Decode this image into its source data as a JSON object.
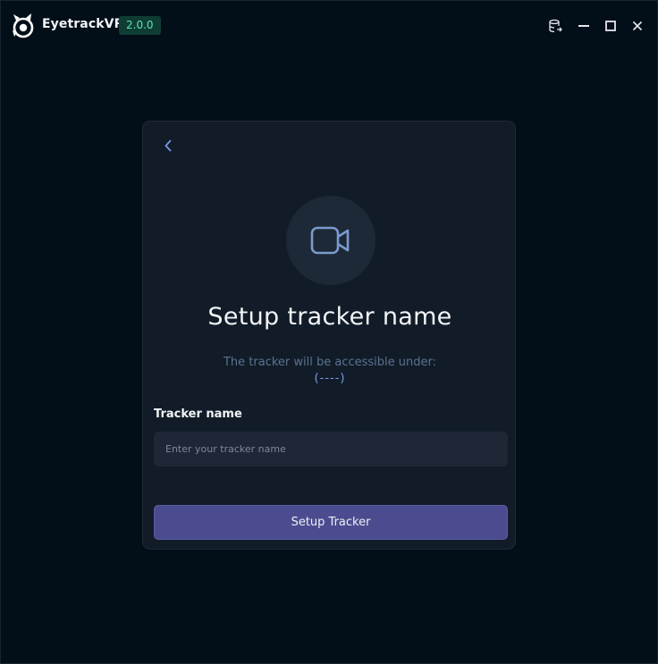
{
  "app": {
    "title": "EyetrackVR",
    "version": "2.0.0"
  },
  "titlebar": {
    "icons": [
      "database-export-icon",
      "minimize-icon",
      "maximize-icon",
      "close-icon"
    ]
  },
  "card": {
    "back_icon": "chevron-left-icon",
    "hero_icon": "video-camera-icon",
    "title": "Setup tracker name",
    "subtitle": "The tracker will be accessible under:",
    "path": "(----)",
    "field_label": "Tracker name",
    "field_placeholder": "Enter your tracker name",
    "field_value": "",
    "submit_label": "Setup Tracker"
  },
  "colors": {
    "background": "#020e18",
    "card": "#111c28",
    "accent_button": "#4b4c8f",
    "version_badge_bg": "#0f3d33",
    "version_badge_text": "#5fe0b4",
    "path_text": "#7a9ae6"
  }
}
